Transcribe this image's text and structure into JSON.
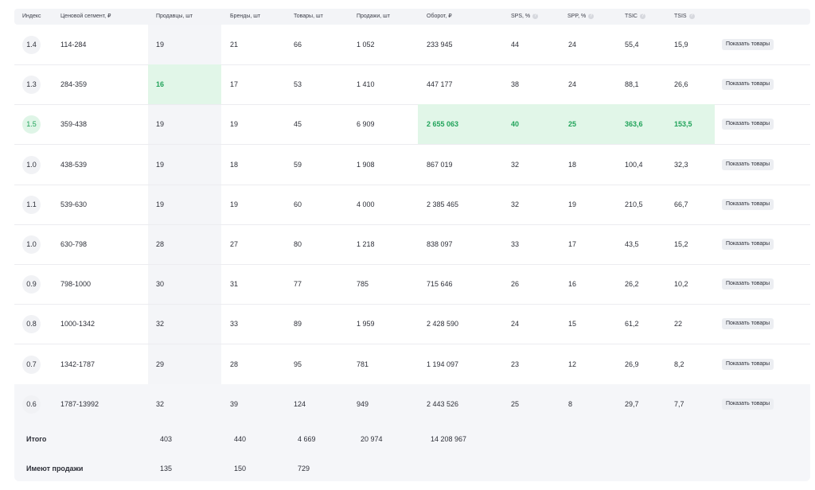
{
  "columns": {
    "index": "Индекс",
    "segment": "Ценовой сегмент, ₽",
    "sellers": "Продавцы, шт",
    "brands": "Бренды, шт",
    "products": "Товары, шт",
    "sales": "Продажи, шт",
    "revenue": "Оборот, ₽",
    "sps": "SPS, %",
    "spp": "SPP, %",
    "tsic": "TSIC",
    "tsis": "TSIS"
  },
  "hint_glyph": "?",
  "button_label": "Показать товары",
  "rows": [
    {
      "index": "1.4",
      "segment": "114-284",
      "sellers": "19",
      "brands": "21",
      "products": "66",
      "sales": "1 052",
      "revenue": "233 945",
      "sps": "44",
      "spp": "24",
      "tsic": "55,4",
      "tsis": "15,9"
    },
    {
      "index": "1.3",
      "segment": "284-359",
      "sellers": "16",
      "brands": "17",
      "products": "53",
      "sales": "1 410",
      "revenue": "447 177",
      "sps": "38",
      "spp": "24",
      "tsic": "88,1",
      "tsis": "26,6"
    },
    {
      "index": "1.5",
      "segment": "359-438",
      "sellers": "19",
      "brands": "19",
      "products": "45",
      "sales": "6 909",
      "revenue": "2 655 063",
      "sps": "40",
      "spp": "25",
      "tsic": "363,6",
      "tsis": "153,5"
    },
    {
      "index": "1.0",
      "segment": "438-539",
      "sellers": "19",
      "brands": "18",
      "products": "59",
      "sales": "1 908",
      "revenue": "867 019",
      "sps": "32",
      "spp": "18",
      "tsic": "100,4",
      "tsis": "32,3"
    },
    {
      "index": "1.1",
      "segment": "539-630",
      "sellers": "19",
      "brands": "19",
      "products": "60",
      "sales": "4 000",
      "revenue": "2 385 465",
      "sps": "32",
      "spp": "19",
      "tsic": "210,5",
      "tsis": "66,7"
    },
    {
      "index": "1.0",
      "segment": "630-798",
      "sellers": "28",
      "brands": "27",
      "products": "80",
      "sales": "1 218",
      "revenue": "838 097",
      "sps": "33",
      "spp": "17",
      "tsic": "43,5",
      "tsis": "15,2"
    },
    {
      "index": "0.9",
      "segment": "798-1000",
      "sellers": "30",
      "brands": "31",
      "products": "77",
      "sales": "785",
      "revenue": "715 646",
      "sps": "26",
      "spp": "16",
      "tsic": "26,2",
      "tsis": "10,2"
    },
    {
      "index": "0.8",
      "segment": "1000-1342",
      "sellers": "32",
      "brands": "33",
      "products": "89",
      "sales": "1 959",
      "revenue": "2 428 590",
      "sps": "24",
      "spp": "15",
      "tsic": "61,2",
      "tsis": "22"
    },
    {
      "index": "0.7",
      "segment": "1342-1787",
      "sellers": "29",
      "brands": "28",
      "products": "95",
      "sales": "781",
      "revenue": "1 194 097",
      "sps": "23",
      "spp": "12",
      "tsic": "26,9",
      "tsis": "8,2"
    },
    {
      "index": "0.6",
      "segment": "1787-13992",
      "sellers": "32",
      "brands": "39",
      "products": "124",
      "sales": "949",
      "revenue": "2 443 526",
      "sps": "25",
      "spp": "8",
      "tsic": "29,7",
      "tsis": "7,7"
    }
  ],
  "totals": {
    "label": "Итого",
    "sellers": "403",
    "brands": "440",
    "products": "4 669",
    "sales": "20 974",
    "revenue": "14 208 967"
  },
  "with_sales": {
    "label": "Имеют продажи",
    "sellers": "135",
    "brands": "150",
    "products": "729"
  },
  "colors": {
    "highlight_text": "#21a35a",
    "highlight_bg": "#e1f6e8",
    "header_bg": "#f3f4f7"
  }
}
